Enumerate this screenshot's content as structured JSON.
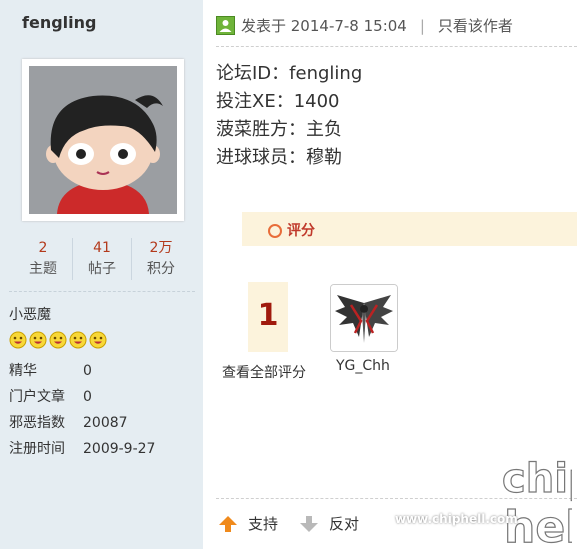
{
  "user": {
    "name": "fengling",
    "stats": [
      {
        "value": "2",
        "label": "主题"
      },
      {
        "value": "41",
        "label": "帖子"
      },
      {
        "value": "2万",
        "label": "积分"
      }
    ],
    "rank": "小恶魔",
    "info": [
      {
        "key": "精华",
        "value": "0"
      },
      {
        "key": "门户文章",
        "value": "0"
      },
      {
        "key": "邪恶指数",
        "value": "20087"
      },
      {
        "key": "注册时间",
        "value": "2009-9-27"
      }
    ]
  },
  "post": {
    "posted_at": "发表于 2014-7-8 15:04",
    "only_author": "只看该作者",
    "lines": [
      "论坛ID：fengling",
      "投注XE：1400",
      "菠菜胜方：主负",
      "进球球员：穆勒"
    ]
  },
  "rating": {
    "title": "评分",
    "count": "1",
    "view_all": "查看全部评分",
    "rater": "YG_Chh"
  },
  "actions": {
    "support": "支持",
    "oppose": "反对"
  },
  "watermark": {
    "text": "chiphell",
    "url": "www.chiphell.com"
  },
  "colors": {
    "sidebar_bg": "#e5edf2",
    "stat_number": "#b33a1c",
    "rate_bg": "#fcf3dc",
    "rate_count": "#a01a0d"
  }
}
